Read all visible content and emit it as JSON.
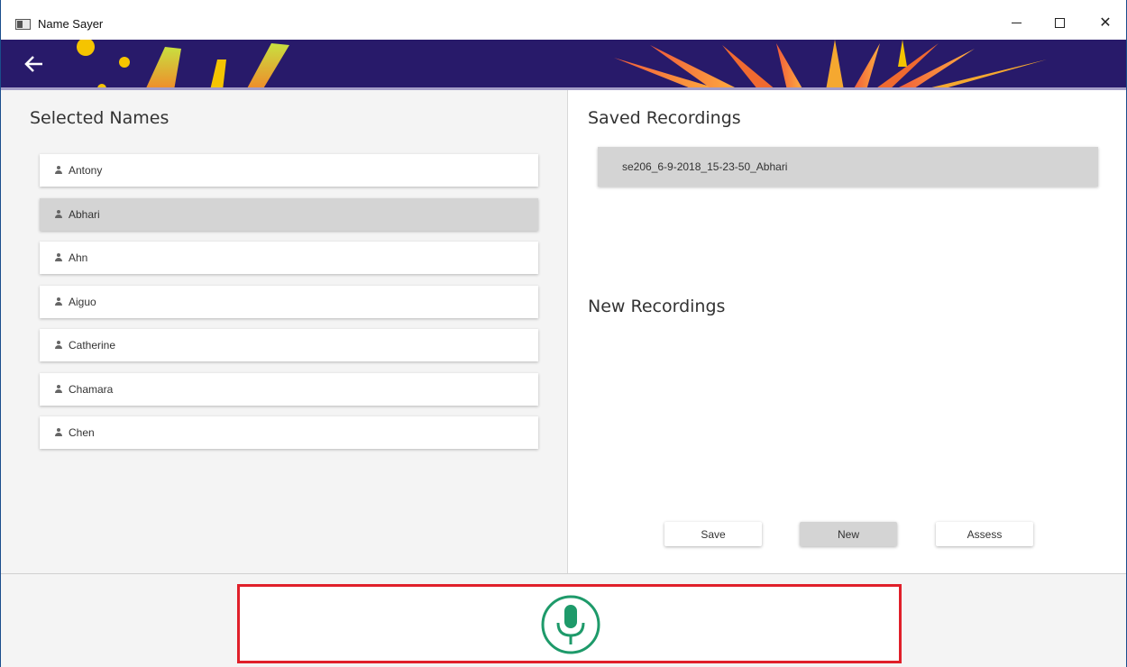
{
  "window": {
    "title": "Name Sayer",
    "minimize_label": "–",
    "maximize_label": "□",
    "close_label": "✕"
  },
  "banner": {
    "back_icon": "arrow-left-icon",
    "background_color": "#281a6a"
  },
  "left_panel": {
    "title": "Selected Names",
    "names": [
      {
        "label": "Antony",
        "selected": false
      },
      {
        "label": "Abhari",
        "selected": true
      },
      {
        "label": "Ahn",
        "selected": false
      },
      {
        "label": "Aiguo",
        "selected": false
      },
      {
        "label": "Catherine",
        "selected": false
      },
      {
        "label": "Chamara",
        "selected": false
      },
      {
        "label": "Chen",
        "selected": false
      }
    ]
  },
  "right_panel": {
    "saved_title": "Saved Recordings",
    "saved_items": [
      "se206_6-9-2018_15-23-50_Abhari"
    ],
    "new_title": "New Recordings",
    "buttons": {
      "save": "Save",
      "new": "New",
      "assess": "Assess"
    }
  },
  "bottom": {
    "mic_icon": "microphone-icon",
    "mic_color": "#1e9a6a",
    "highlight_color": "#e0202a"
  }
}
